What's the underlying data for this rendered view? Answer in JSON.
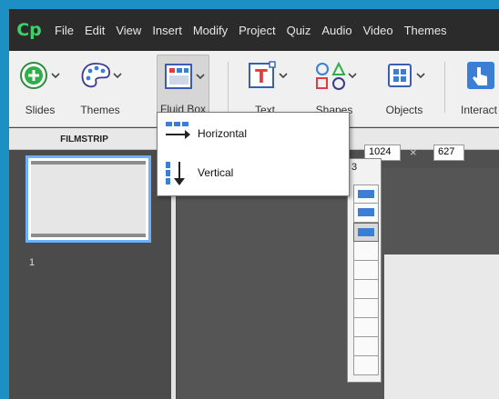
{
  "app": {
    "logo": "Cp",
    "menu": [
      "File",
      "Edit",
      "View",
      "Insert",
      "Modify",
      "Project",
      "Quiz",
      "Audio",
      "Video",
      "Themes"
    ]
  },
  "toolbar": {
    "slides": "Slides",
    "themes": "Themes",
    "fluid_box": "Fluid Box",
    "text": "Text",
    "shapes": "Shapes",
    "objects": "Objects",
    "interactions": "Interact"
  },
  "filmstrip": {
    "title": "FILMSTRIP",
    "slide_number": "1"
  },
  "stage": {
    "width": "1024",
    "times": "×",
    "height": "627"
  },
  "fluid_box_menu": {
    "horizontal": "Horizontal",
    "vertical": "Vertical"
  },
  "fluid_box_count": {
    "label": "3",
    "rows": 10,
    "selected": 3
  },
  "colors": {
    "accent_blue": "#3a7ed6",
    "logo_green": "#3ecf6a",
    "window_border": "#1c8fc4"
  }
}
